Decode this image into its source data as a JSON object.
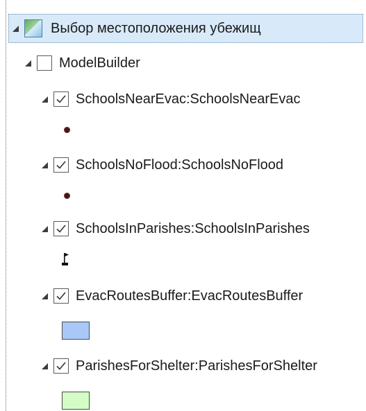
{
  "tree": {
    "root": {
      "label": "Выбор местоположения убежищ",
      "icon": "map-icon"
    },
    "group": {
      "label": "ModelBuilder",
      "checked": false
    },
    "layers": [
      {
        "label": "SchoolsNearEvac:SchoolsNearEvac",
        "checked": true,
        "symbol": "point-dot",
        "symbol_color": "#3d1a1a"
      },
      {
        "label": "SchoolsNoFlood:SchoolsNoFlood",
        "checked": true,
        "symbol": "point-dot",
        "symbol_color": "#3d1a1a"
      },
      {
        "label": "SchoolsInParishes:SchoolsInParishes",
        "checked": true,
        "symbol": "flag-marker",
        "symbol_color": "#111111"
      },
      {
        "label": "EvacRoutesBuffer:EvacRoutesBuffer",
        "checked": true,
        "symbol": "polygon-swatch",
        "symbol_color": "#a9c8f7"
      },
      {
        "label": "ParishesForShelter:ParishesForShelter",
        "checked": true,
        "symbol": "polygon-swatch",
        "symbol_color": "#d4fcc7"
      }
    ]
  },
  "colors": {
    "selection_background": "#d8eaf9",
    "text": "#1a1a1a"
  }
}
